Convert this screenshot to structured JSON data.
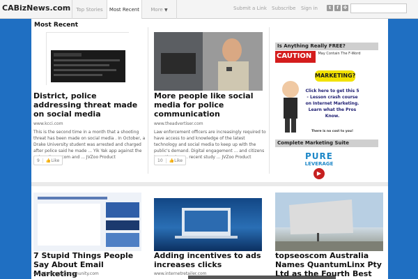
{
  "header": {
    "logo": "CABizNews.com",
    "tabs": [
      {
        "label": "Top Stories"
      },
      {
        "label": "Most Recent"
      },
      {
        "label": "More"
      }
    ],
    "links": {
      "submit": "Submit a Link",
      "subscribe": "Subscribe",
      "signin": "Sign in"
    },
    "social": [
      "twitter-icon",
      "facebook-icon",
      "rss-icon"
    ]
  },
  "main": {
    "section_title": "Most Recent",
    "articles": [
      {
        "title": "District, police addressing threat made on social media",
        "source": "www.kcci.com",
        "excerpt": "This is the second time in a month that a shooting threat has been made on social media . In October, a Drake University student was arrested and charged after police said he made ... Yik Yak app against the university. ... com and ... JVZoo Product",
        "likes": "9",
        "like_label": "Like"
      },
      {
        "title": "More people like social media for police communication",
        "source": "www.theadvertiser.com",
        "excerpt": "Law enforcement officers are increasingly required to have access to and knowledge of the latest technology and social media to keep up with the public's demand. Digital engagement ... and citizens is on the rise, ... recent study ... JVZoo Product",
        "likes": "10",
        "like_label": "Like"
      },
      {
        "title": "7 Stupid Things People Say About Email Marketing",
        "source": "www.business2community.com"
      },
      {
        "title": "Adding incentives to ads increases clicks",
        "source": "www.internetretailer.com"
      },
      {
        "title": "topseoscom Australia Names QuantumLinx Pty Ltd as the Fourth Best"
      }
    ]
  },
  "sidebar": {
    "ad1_heading": "Is Anything Really FREE?",
    "ad1": {
      "caution": "CAUTION",
      "caution_note": "May Contain The F-Word",
      "marketing": "MARKETING?",
      "body": "Click here to get this 5 - Lesson crash course on Internet Marketing. Learn what the Pros Know.",
      "footer": "There is no cost to you!"
    },
    "ad2_heading": "Complete Marketing Suite",
    "ad2": {
      "line1": "PURE",
      "line2": "LEVERAGE"
    }
  },
  "colors": {
    "background": "#1f6fc2",
    "topbar": "#f4f4f4",
    "caution_red": "#d41c1c",
    "marketing_yellow": "#f2e200"
  }
}
